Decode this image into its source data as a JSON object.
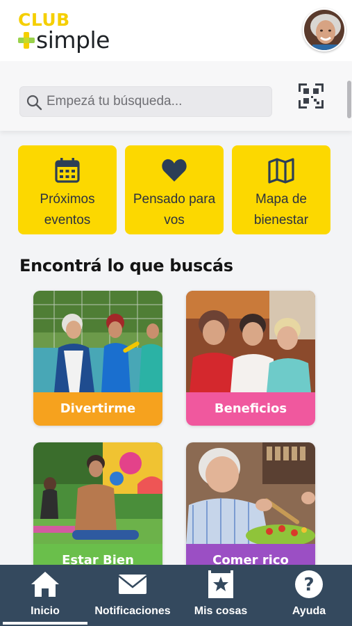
{
  "header": {
    "logo_club": "CLUB",
    "logo_simple": "simple",
    "avatar_icon": "user-avatar"
  },
  "search": {
    "placeholder": "Empezá tu búsqueda...",
    "search_icon": "search-icon",
    "qr_icon": "qr-code-icon"
  },
  "quick_tiles": [
    {
      "label_line1": "Próximos",
      "label_line2": "eventos",
      "icon": "calendar-icon"
    },
    {
      "label_line1": "Pensado para",
      "label_line2": "vos",
      "icon": "heart-icon"
    },
    {
      "label_line1": "Mapa de",
      "label_line2": "bienestar",
      "icon": "map-icon"
    }
  ],
  "section": {
    "title": "Encontrá lo que buscás"
  },
  "categories": [
    {
      "label": "Divertirme",
      "color": "#f6a21e"
    },
    {
      "label": "Beneficios",
      "color": "#f0589e"
    },
    {
      "label": "Estar Bien",
      "color": "#6abf4b"
    },
    {
      "label": "Comer rico",
      "color": "#9b4fc4"
    }
  ],
  "bottom_nav": {
    "items": [
      {
        "label": "Inicio",
        "icon": "home-icon",
        "active": true
      },
      {
        "label": "Notificaciones",
        "icon": "envelope-icon",
        "active": false
      },
      {
        "label": "Mis cosas",
        "icon": "star-bookmark-icon",
        "active": false
      },
      {
        "label": "Ayuda",
        "icon": "help-icon",
        "active": false
      }
    ]
  },
  "colors": {
    "brand_yellow": "#fcd800",
    "nav_background": "#34495e",
    "logo_text": "#1e2226"
  }
}
